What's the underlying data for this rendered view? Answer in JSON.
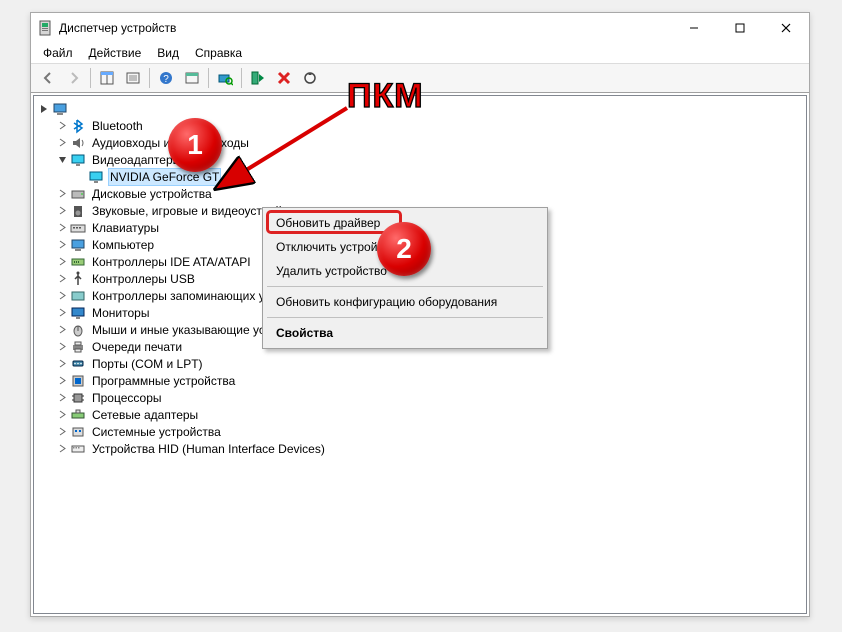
{
  "window": {
    "title": "Диспетчер устройств"
  },
  "menubar": {
    "file": "Файл",
    "action": "Действие",
    "view": "Вид",
    "help": "Справка"
  },
  "tree": {
    "root": "",
    "bluetooth": "Bluetooth",
    "audio": "Аудиовходы и аудиовыходы",
    "video": "Видеоадаптеры",
    "nvidia": "NVIDIA GeForce GT",
    "disk": "Дисковые устройства",
    "sound": "Звуковые, игровые и видеоустройства",
    "keyboard": "Клавиатуры",
    "computer": "Компьютер",
    "ide": "Контроллеры IDE ATA/ATAPI",
    "usb": "Контроллеры USB",
    "storage": "Контроллеры запоминающих устройств",
    "monitors": "Мониторы",
    "mouse": "Мыши и иные указывающие устройства",
    "print": "Очереди печати",
    "ports": "Порты (COM и LPT)",
    "software": "Программные устройства",
    "cpu": "Процессоры",
    "network": "Сетевые адаптеры",
    "system": "Системные устройства",
    "hid": "Устройства HID (Human Interface Devices)"
  },
  "context_menu": {
    "update_driver": "Обновить драйвер",
    "disable_device": "Отключить устройство",
    "remove_device": "Удалить устройство",
    "refresh_config": "Обновить конфигурацию оборудования",
    "properties": "Свойства"
  },
  "annotations": {
    "pkm": "ПКМ",
    "badge1": "1",
    "badge2": "2"
  }
}
